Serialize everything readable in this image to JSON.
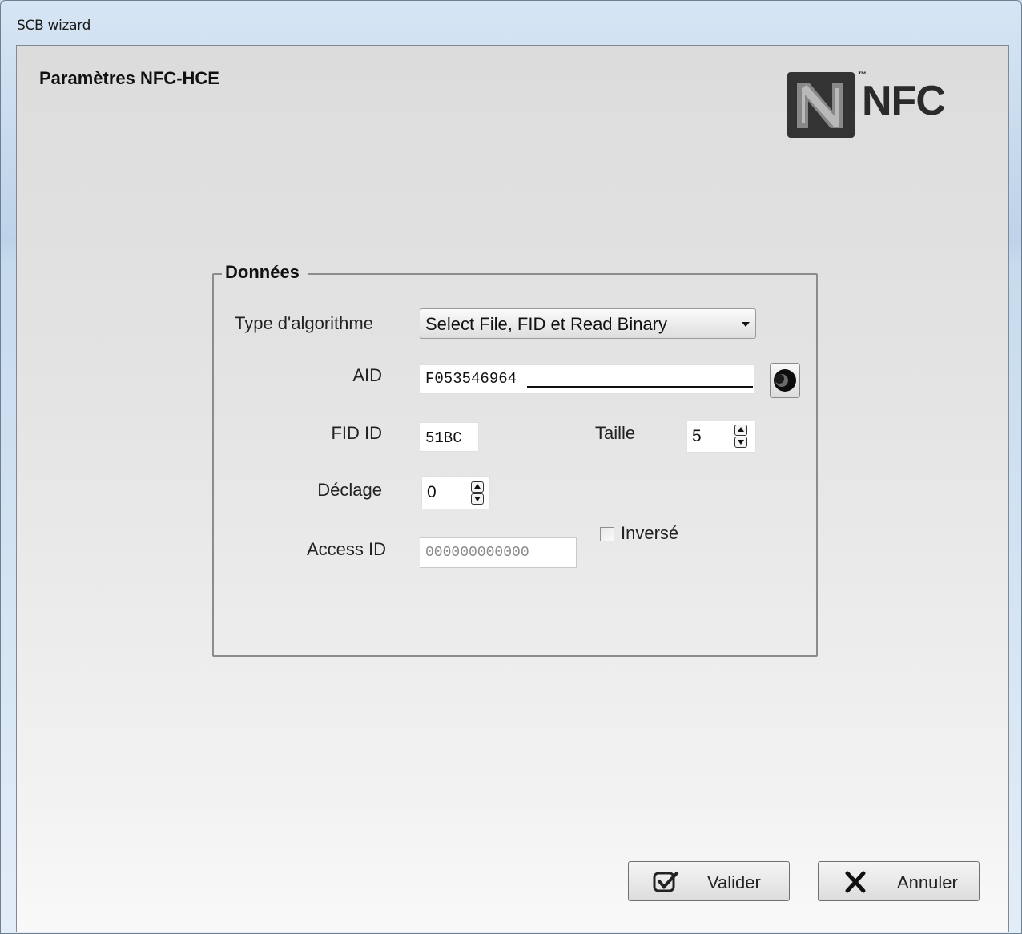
{
  "window": {
    "title": "SCB wizard"
  },
  "page": {
    "title": "Paramètres NFC-HCE"
  },
  "logo": {
    "text": "NFC",
    "tm": "™"
  },
  "group": {
    "legend": "Données",
    "algorithm": {
      "label": "Type d'algorithme",
      "value": "Select File, FID et Read Binary"
    },
    "aid": {
      "label": "AID",
      "value": "F053546964"
    },
    "fid": {
      "label": "FID ID",
      "value": "51BC"
    },
    "taille": {
      "label": "Taille",
      "value": "5"
    },
    "declage": {
      "label": "Déclage",
      "value": "0"
    },
    "inverse": {
      "label": "Inversé",
      "checked": false
    },
    "access": {
      "label": "Access ID",
      "placeholder": "000000000000"
    }
  },
  "buttons": {
    "validate": "Valider",
    "cancel": "Annuler"
  }
}
